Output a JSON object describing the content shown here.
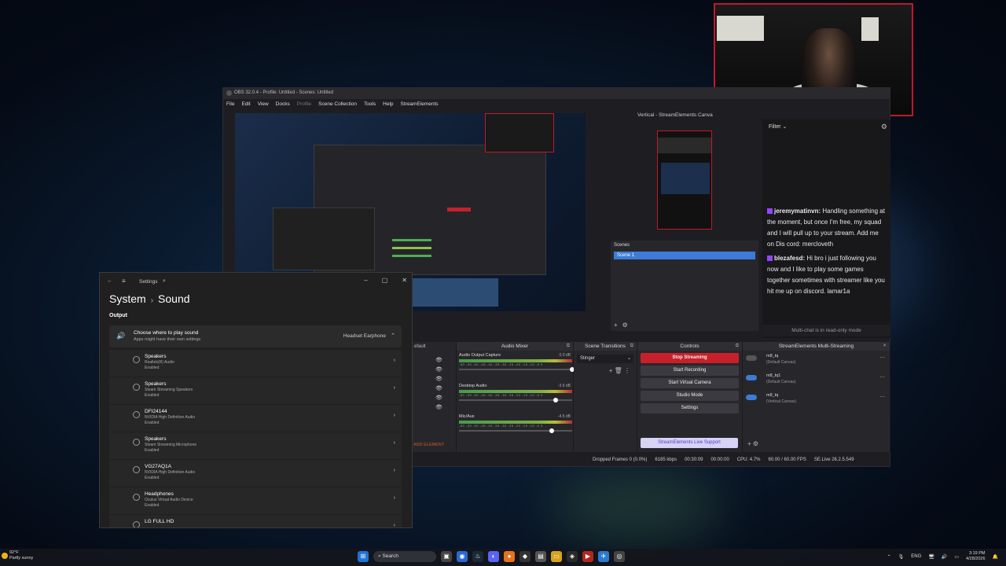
{
  "obs": {
    "title": "OBS 32.0.4 - Profile: Untitled - Scenes: Untitled",
    "menu": [
      "File",
      "Edit",
      "View",
      "Docks",
      "Profile",
      "Scene Collection",
      "Tools",
      "Help",
      "StreamElements"
    ],
    "vertical_canvas_title": "Vertical - StreamElements Canva",
    "scenes_header": "Scenes",
    "scene_item": "Scene 1",
    "chat": {
      "filter": "Filter",
      "messages": [
        {
          "user": "jeremymatinvn:",
          "text": "Handling something at the moment, but once I'm free, my squad and I will pull up to your stream. Add me on Dis cord: mercloveth"
        },
        {
          "user": "blezafesd:",
          "text": "Hi bro i just following you now and I like to play some games together sometimes with streamer like you hit me up on discord. lamar1a"
        }
      ],
      "readonly": "Multi-chat is in read-only mode"
    },
    "docks": {
      "sources_default": "efault",
      "add_element": "ADD ELEMENT",
      "mixer_title": "Audio Mixer",
      "mixer": [
        {
          "name": "Audio Output Capture",
          "db": "0.0 dB"
        },
        {
          "name": "Desktop Audio",
          "db": "-3.5 dB"
        },
        {
          "name": "Mic/Aux",
          "db": "-4.5 dB"
        }
      ],
      "meter_scale": "-60 -55 -50 -45 -40 -35 -30 -25 -20 -15 -10 -5 0",
      "transitions_title": "Scene Transitions",
      "transition_value": "Stinger",
      "controls_title": "Controls",
      "controls": [
        "Stop Streaming",
        "Start Recording",
        "Start Virtual Camera",
        "Studio Mode",
        "Settings"
      ],
      "se_support": "StreamElements Live Support",
      "multistream_title": "StreamElements Multi-Streaming",
      "multistream": [
        {
          "name": "m8_tq",
          "canvas": "(Default Canvas)"
        },
        {
          "name": "m8_tq1",
          "canvas": "(Default Canvas)"
        },
        {
          "name": "m8_tq",
          "canvas": "(Vertical Canvas)"
        }
      ]
    },
    "status": {
      "dropped": "Dropped Frames 0 (0.0%)",
      "kbps": "6185 kbps",
      "stream_time": "00:30:09",
      "rec_time": "00:00:00",
      "cpu": "CPU: 4.7%",
      "fps": "60.00 / 60.00 FPS",
      "version": "SE.Live 26.2.5.549"
    }
  },
  "settings": {
    "title": "Settings",
    "crumb_parent": "System",
    "crumb_current": "Sound",
    "output_header": "Output",
    "choose_title": "Choose where to play sound",
    "choose_sub": "Apps might have their own settings",
    "choose_value": "Headset Earphone",
    "devices": [
      {
        "name": "Speakers",
        "desc": "Realtek(R) Audio",
        "state": "Enabled"
      },
      {
        "name": "Speakers",
        "desc": "Steam Streaming Speakers",
        "state": "Enabled"
      },
      {
        "name": "DFI24144",
        "desc": "NVIDIA High Definition Audio",
        "state": "Enabled"
      },
      {
        "name": "Speakers",
        "desc": "Steam Streaming Microphone",
        "state": "Enabled"
      },
      {
        "name": "VG27AQ1A",
        "desc": "NVIDIA High Definition Audio",
        "state": "Enabled"
      },
      {
        "name": "Headphones",
        "desc": "Oculus Virtual Audio Device",
        "state": "Enabled"
      },
      {
        "name": "LG FULL HD",
        "desc": "",
        "state": ""
      }
    ]
  },
  "taskbar": {
    "temp": "92°F",
    "weather": "Partly sunny",
    "search": "Search",
    "lang": "ENG",
    "time": "3:19 PM",
    "date": "4/28/2026"
  },
  "colors": {
    "accent": "#3d7bd8",
    "stop_red": "#c8202a",
    "twitch": "#9146ff"
  }
}
